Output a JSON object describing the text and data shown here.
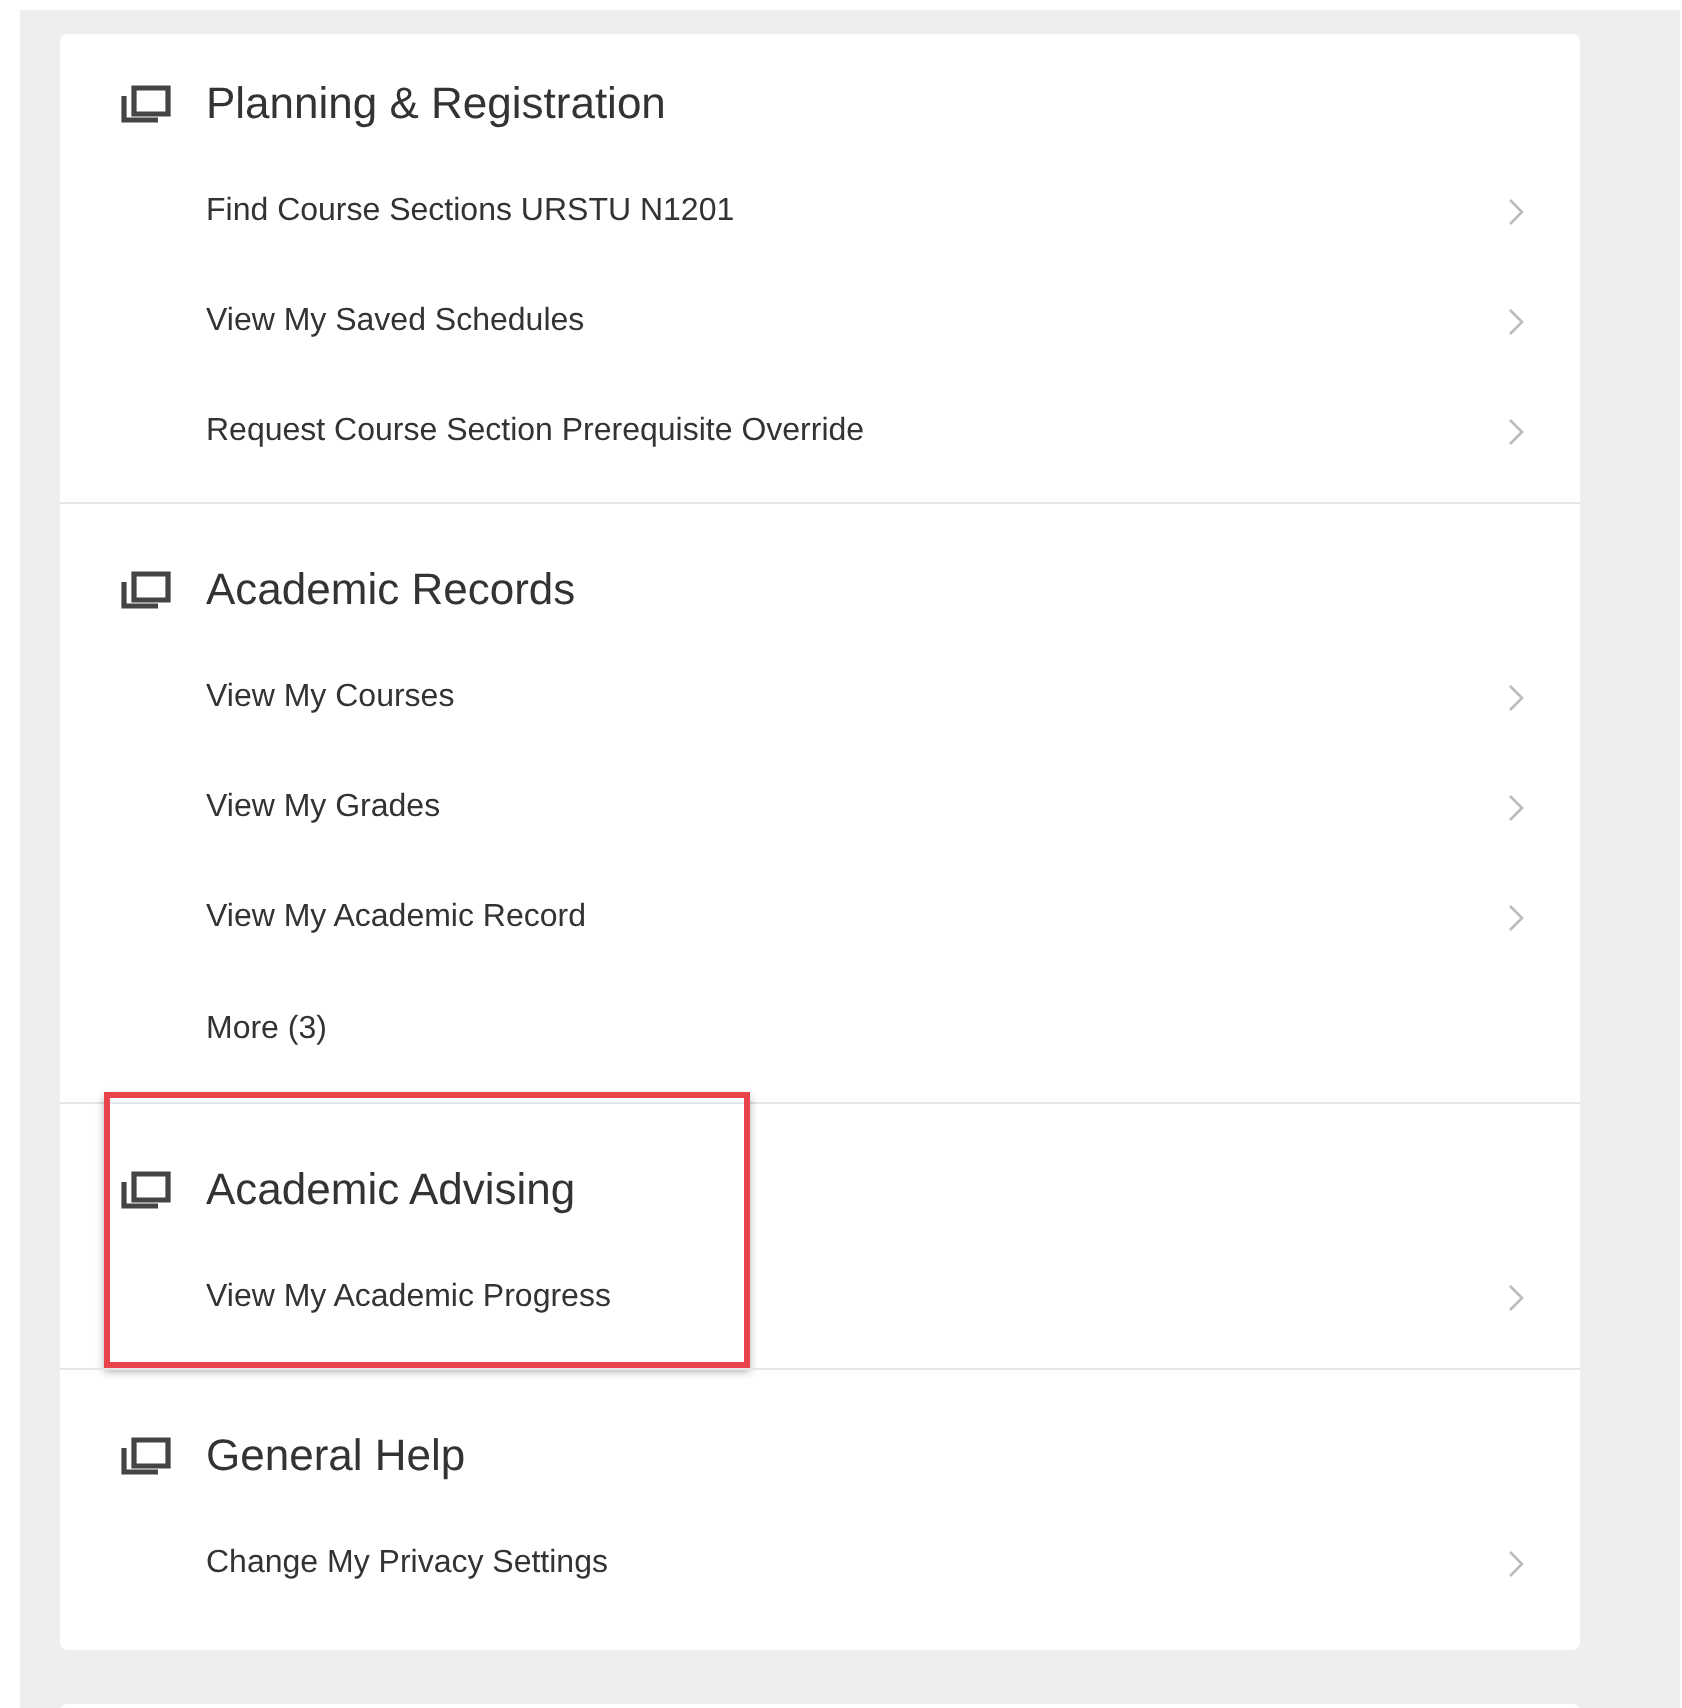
{
  "sections": [
    {
      "title": "Planning & Registration",
      "highlighted": false,
      "items": [
        {
          "label": "Find Course Sections URSTU N1201",
          "chevron": true
        },
        {
          "label": "View My Saved Schedules",
          "chevron": true
        },
        {
          "label": "Request Course Section Prerequisite Override",
          "chevron": true
        }
      ]
    },
    {
      "title": "Academic Records",
      "highlighted": false,
      "items": [
        {
          "label": "View My Courses",
          "chevron": true
        },
        {
          "label": "View My Grades",
          "chevron": true
        },
        {
          "label": "View My Academic Record",
          "chevron": true
        },
        {
          "label": "More (3)",
          "chevron": false
        }
      ]
    },
    {
      "title": "Academic Advising",
      "highlighted": true,
      "items": [
        {
          "label": "View My Academic Progress",
          "chevron": true
        }
      ]
    },
    {
      "title": "General Help",
      "highlighted": false,
      "items": [
        {
          "label": "Change My Privacy Settings",
          "chevron": true
        }
      ]
    }
  ]
}
